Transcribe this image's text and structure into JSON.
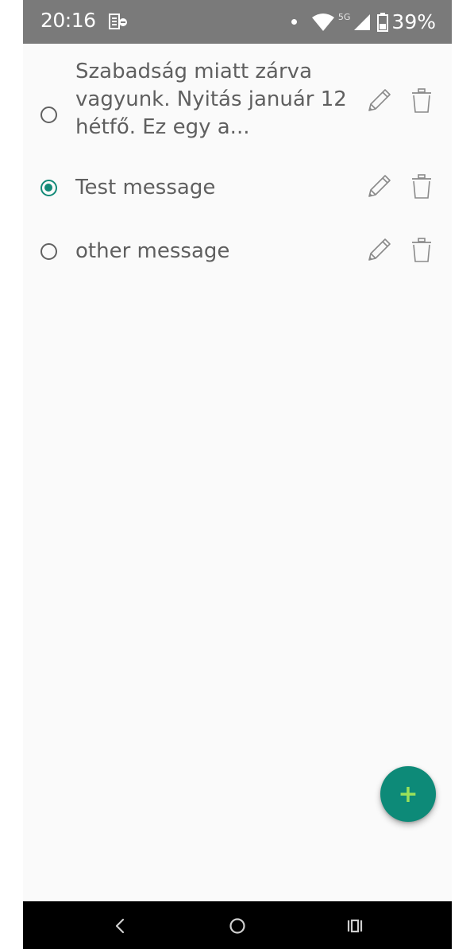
{
  "status_bar": {
    "time": "20:16",
    "network": "5G",
    "battery": "39%",
    "icons": [
      "notification-app-icon",
      "dot-icon",
      "wifi-icon",
      "signal-icon",
      "battery-icon"
    ]
  },
  "messages": [
    {
      "text": "Szabadság miatt zárva vagyunk. Nyitás január 12 hétfő. Ez egy a...",
      "selected": false
    },
    {
      "text": "Test message",
      "selected": true
    },
    {
      "text": "other message",
      "selected": false
    }
  ],
  "fab": {
    "label": "+"
  },
  "colors": {
    "accent": "#138a78",
    "fab": "#0d8a78",
    "fab_plus": "#9be15a",
    "status_bar": "#7a7a7a",
    "text": "#5f5f5f"
  },
  "nav": {
    "icons": [
      "back-icon",
      "home-icon",
      "recents-icon"
    ]
  }
}
